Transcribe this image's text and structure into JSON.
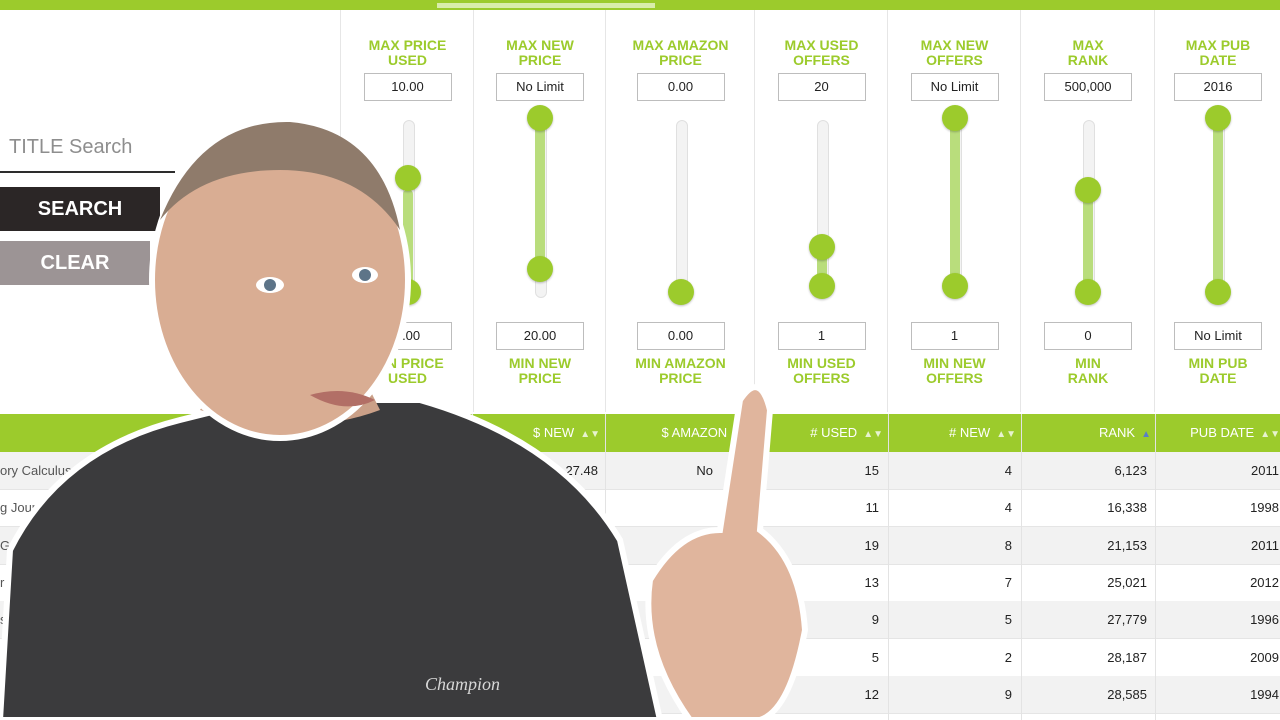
{
  "search": {
    "title_placeholder": "TITLE Search",
    "search_label": "SEARCH",
    "clear_label": "CLEAR"
  },
  "filters": [
    {
      "top_label": "MAX PRICE\nUSED",
      "top_value": "10.00",
      "bottom_value": "0.00",
      "bottom_label": "MIN PRICE\nUSED"
    },
    {
      "top_label": "MAX NEW\nPRICE",
      "top_value": "No Limit",
      "bottom_value": "20.00",
      "bottom_label": "MIN NEW\nPRICE"
    },
    {
      "top_label": "MAX AMAZON\nPRICE",
      "top_value": "0.00",
      "bottom_value": "0.00",
      "bottom_label": "MIN AMAZON\nPRICE"
    },
    {
      "top_label": "MAX USED\nOFFERS",
      "top_value": "20",
      "bottom_value": "1",
      "bottom_label": "MIN USED\nOFFERS"
    },
    {
      "top_label": "MAX NEW\nOFFERS",
      "top_value": "No Limit",
      "bottom_value": "1",
      "bottom_label": "MIN NEW\nOFFERS"
    },
    {
      "top_label": "MAX\nRANK",
      "top_value": "500,000",
      "bottom_value": "0",
      "bottom_label": "MIN\nRANK"
    },
    {
      "top_label": "MAX PUB\nDATE",
      "top_value": "2016",
      "bottom_value": "No Limit",
      "bottom_label": "MIN PUB\nDATE"
    }
  ],
  "table": {
    "headers": [
      "$ NEW",
      "$ AMAZON",
      "# USED",
      "# NEW",
      "RANK",
      "PUB DATE"
    ],
    "rows": [
      {
        "title": "ory Calculus For Infa...",
        "new": "27.48",
        "amazon": "No",
        "used": "15",
        "new_count": "4",
        "rank": "6,123",
        "pub": "2011"
      },
      {
        "title": "g Journalist's P...",
        "new": "",
        "amazon": "",
        "used": "11",
        "new_count": "4",
        "rank": "16,338",
        "pub": "1998"
      },
      {
        "title": "Gover...",
        "new": "",
        "amazon": "",
        "used": "19",
        "new_count": "8",
        "rank": "21,153",
        "pub": "2011"
      },
      {
        "title": "r Kid...",
        "new": "",
        "amazon": "",
        "used": "13",
        "new_count": "7",
        "rank": "25,021",
        "pub": "2012"
      },
      {
        "title": "s",
        "new": "",
        "amazon": "",
        "used": "9",
        "new_count": "5",
        "rank": "27,779",
        "pub": "1996"
      },
      {
        "title": "",
        "new": "",
        "amazon": "",
        "used": "5",
        "new_count": "2",
        "rank": "28,187",
        "pub": "2009"
      },
      {
        "title": "",
        "new": "",
        "amazon": "",
        "used": "12",
        "new_count": "9",
        "rank": "28,585",
        "pub": "1994"
      }
    ]
  },
  "colors": {
    "accent": "#9ccb2c",
    "dark": "#2b2626",
    "gray_button": "#9c9495"
  },
  "presenter": {
    "shirt_text": "Champion"
  }
}
